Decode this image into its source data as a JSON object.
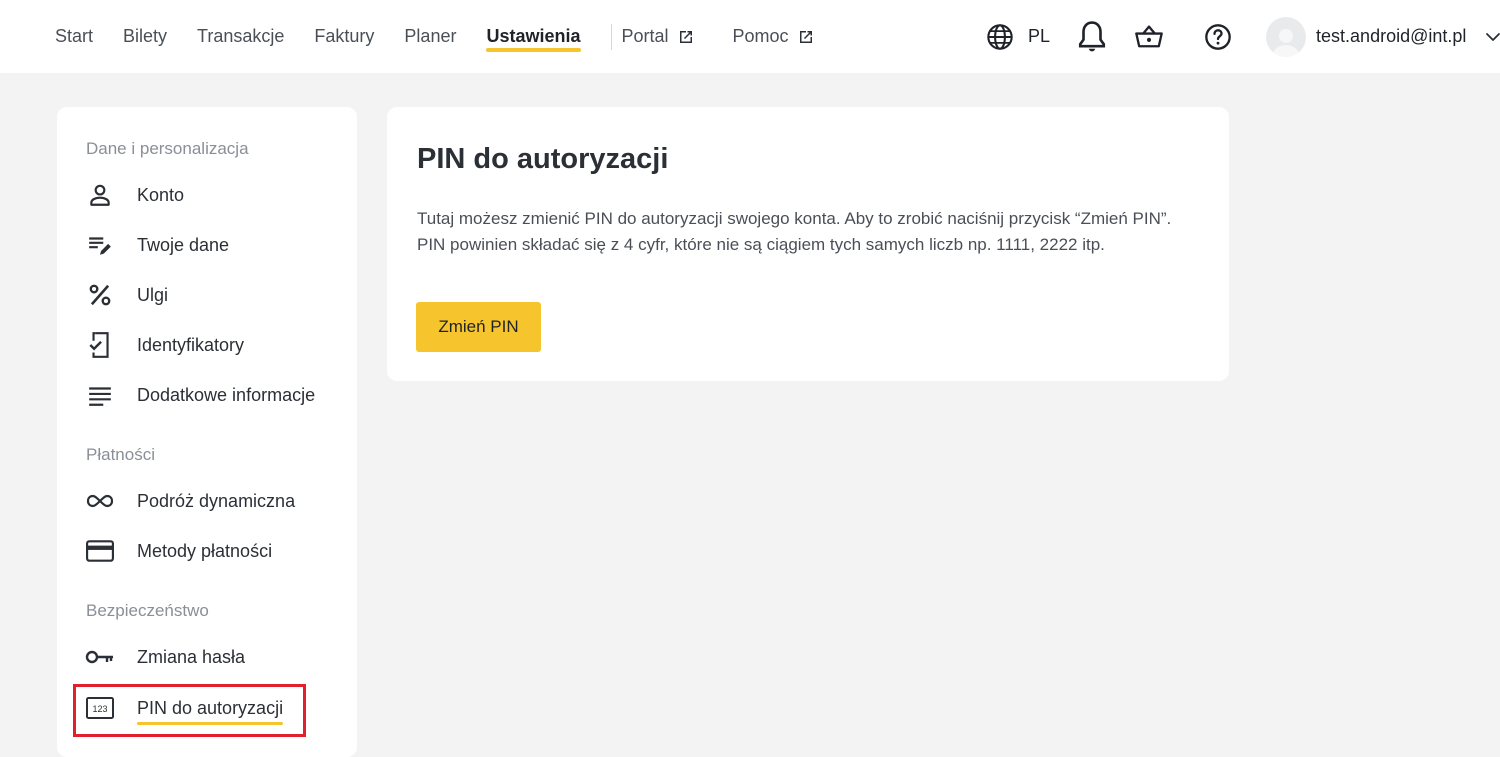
{
  "nav": {
    "items": [
      "Start",
      "Bilety",
      "Transakcje",
      "Faktury",
      "Planer",
      "Ustawienia"
    ],
    "active": "Ustawienia",
    "external": [
      "Portal",
      "Pomoc"
    ],
    "external_icon": "external-link-icon"
  },
  "tools": {
    "language": "PL",
    "icons": [
      "globe-icon",
      "bell-icon",
      "basket-icon",
      "help-icon",
      "avatar",
      "chevron-down-icon"
    ],
    "user_email": "test.android@int.pl"
  },
  "sidebar": {
    "sections": [
      {
        "title": "Dane i personalizacja",
        "items": [
          {
            "label": "Konto",
            "icon": "person-icon"
          },
          {
            "label": "Twoje dane",
            "icon": "edit-list-icon"
          },
          {
            "label": "Ulgi",
            "icon": "percent-icon"
          },
          {
            "label": "Identyfikatory",
            "icon": "phone-check-icon"
          },
          {
            "label": "Dodatkowe informacje",
            "icon": "notes-icon"
          }
        ]
      },
      {
        "title": "Płatności",
        "items": [
          {
            "label": "Podróż dynamiczna",
            "icon": "infinity-icon"
          },
          {
            "label": "Metody płatności",
            "icon": "credit-card-icon"
          }
        ]
      },
      {
        "title": "Bezpieczeństwo",
        "items": [
          {
            "label": "Zmiana hasła",
            "icon": "key-icon"
          },
          {
            "label": "PIN do autoryzacji",
            "icon": "pin-123-icon",
            "active": true
          }
        ]
      }
    ]
  },
  "main": {
    "title": "PIN do autoryzacji",
    "description": "Tutaj możesz zmienić PIN do autoryzacji swojego konta. Aby to zrobić naciśnij przycisk “Zmień PIN”. PIN powinien składać się z 4 cyfr, które nie są ciągiem tych samych liczb np. 1111, 2222 itp.",
    "button_label": "Zmień PIN"
  },
  "colors": {
    "accent": "#f6c42c",
    "highlight": "#e0202a",
    "background": "#f3f3f4"
  }
}
